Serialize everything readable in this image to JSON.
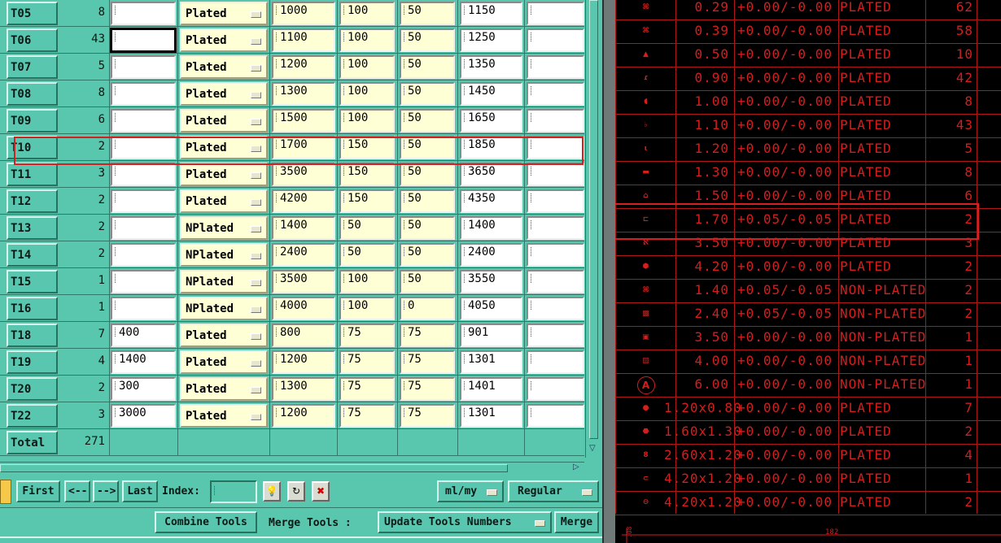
{
  "table": {
    "rows": [
      {
        "tool": "T05",
        "count": "8",
        "f1": "",
        "plating": "Plated",
        "size": "1000",
        "tol_plus": "100",
        "tol_minus": "50",
        "total": "1150",
        "f2": ""
      },
      {
        "tool": "T06",
        "count": "43",
        "f1": "",
        "plating": "Plated",
        "size": "1100",
        "tol_plus": "100",
        "tol_minus": "50",
        "total": "1250",
        "f2": ""
      },
      {
        "tool": "T07",
        "count": "5",
        "f1": "",
        "plating": "Plated",
        "size": "1200",
        "tol_plus": "100",
        "tol_minus": "50",
        "total": "1350",
        "f2": ""
      },
      {
        "tool": "T08",
        "count": "8",
        "f1": "",
        "plating": "Plated",
        "size": "1300",
        "tol_plus": "100",
        "tol_minus": "50",
        "total": "1450",
        "f2": ""
      },
      {
        "tool": "T09",
        "count": "6",
        "f1": "",
        "plating": "Plated",
        "size": "1500",
        "tol_plus": "100",
        "tol_minus": "50",
        "total": "1650",
        "f2": ""
      },
      {
        "tool": "T10",
        "count": "2",
        "f1": "",
        "plating": "Plated",
        "size": "1700",
        "tol_plus": "150",
        "tol_minus": "50",
        "total": "1850",
        "f2": ""
      },
      {
        "tool": "T11",
        "count": "3",
        "f1": "",
        "plating": "Plated",
        "size": "3500",
        "tol_plus": "150",
        "tol_minus": "50",
        "total": "3650",
        "f2": ""
      },
      {
        "tool": "T12",
        "count": "2",
        "f1": "",
        "plating": "Plated",
        "size": "4200",
        "tol_plus": "150",
        "tol_minus": "50",
        "total": "4350",
        "f2": ""
      },
      {
        "tool": "T13",
        "count": "2",
        "f1": "",
        "plating": "NPlated",
        "size": "1400",
        "tol_plus": "50",
        "tol_minus": "50",
        "total": "1400",
        "f2": ""
      },
      {
        "tool": "T14",
        "count": "2",
        "f1": "",
        "plating": "NPlated",
        "size": "2400",
        "tol_plus": "50",
        "tol_minus": "50",
        "total": "2400",
        "f2": ""
      },
      {
        "tool": "T15",
        "count": "1",
        "f1": "",
        "plating": "NPlated",
        "size": "3500",
        "tol_plus": "100",
        "tol_minus": "50",
        "total": "3550",
        "f2": ""
      },
      {
        "tool": "T16",
        "count": "1",
        "f1": "",
        "plating": "NPlated",
        "size": "4000",
        "tol_plus": "100",
        "tol_minus": "0",
        "total": "4050",
        "f2": ""
      },
      {
        "tool": "T18",
        "count": "7",
        "f1": "400",
        "plating": "Plated",
        "size": "800",
        "tol_plus": "75",
        "tol_minus": "75",
        "total": "901",
        "f2": ""
      },
      {
        "tool": "T19",
        "count": "4",
        "f1": "1400",
        "plating": "Plated",
        "size": "1200",
        "tol_plus": "75",
        "tol_minus": "75",
        "total": "1301",
        "f2": ""
      },
      {
        "tool": "T20",
        "count": "2",
        "f1": "300",
        "plating": "Plated",
        "size": "1300",
        "tol_plus": "75",
        "tol_minus": "75",
        "total": "1401",
        "f2": ""
      },
      {
        "tool": "T22",
        "count": "3",
        "f1": "3000",
        "plating": "Plated",
        "size": "1200",
        "tol_plus": "75",
        "tol_minus": "75",
        "total": "1301",
        "f2": ""
      }
    ],
    "total_label": "Total",
    "total_count": "271"
  },
  "nav": {
    "first": "First",
    "prev": "<--",
    "next": "-->",
    "last": "Last",
    "index_label": "Index:",
    "index_value": "",
    "units": "ml/my",
    "mode": "Regular"
  },
  "actions": {
    "combine": "Combine Tools",
    "merge_label": "Merge Tools :",
    "update": "Update Tools Numbers",
    "merge": "Merge"
  },
  "drill_chart": {
    "rows": [
      {
        "size": "0.29",
        "tol": "+0.00/-0.00",
        "type": "PLATED",
        "qty": "62"
      },
      {
        "size": "0.39",
        "tol": "+0.00/-0.00",
        "type": "PLATED",
        "qty": "58"
      },
      {
        "size": "0.50",
        "tol": "+0.00/-0.00",
        "type": "PLATED",
        "qty": "10"
      },
      {
        "size": "0.90",
        "tol": "+0.00/-0.00",
        "type": "PLATED",
        "qty": "42"
      },
      {
        "size": "1.00",
        "tol": "+0.00/-0.00",
        "type": "PLATED",
        "qty": "8"
      },
      {
        "size": "1.10",
        "tol": "+0.00/-0.00",
        "type": "PLATED",
        "qty": "43"
      },
      {
        "size": "1.20",
        "tol": "+0.00/-0.00",
        "type": "PLATED",
        "qty": "5"
      },
      {
        "size": "1.30",
        "tol": "+0.00/-0.00",
        "type": "PLATED",
        "qty": "8"
      },
      {
        "size": "1.50",
        "tol": "+0.00/-0.00",
        "type": "PLATED",
        "qty": "6"
      },
      {
        "size": "1.70",
        "tol": "+0.05/-0.05",
        "type": "PLATED",
        "qty": "2"
      },
      {
        "size": "3.50",
        "tol": "+0.00/-0.00",
        "type": "PLATED",
        "qty": "3"
      },
      {
        "size": "4.20",
        "tol": "+0.00/-0.00",
        "type": "PLATED",
        "qty": "2"
      },
      {
        "size": "1.40",
        "tol": "+0.05/-0.05",
        "type": "NON-PLATED",
        "qty": "2"
      },
      {
        "size": "2.40",
        "tol": "+0.05/-0.05",
        "type": "NON-PLATED",
        "qty": "2"
      },
      {
        "size": "3.50",
        "tol": "+0.00/-0.00",
        "type": "NON-PLATED",
        "qty": "1"
      },
      {
        "size": "4.00",
        "tol": "+0.00/-0.00",
        "type": "NON-PLATED",
        "qty": "1"
      },
      {
        "size": "6.00",
        "tol": "+0.00/-0.00",
        "type": "NON-PLATED",
        "qty": "1"
      },
      {
        "size": "1.20x0.80",
        "tol": "+0.00/-0.00",
        "type": "PLATED",
        "qty": "7"
      },
      {
        "size": "1.60x1.30",
        "tol": "+0.00/-0.00",
        "type": "PLATED",
        "qty": "2"
      },
      {
        "size": "2.60x1.20",
        "tol": "+0.00/-0.00",
        "type": "PLATED",
        "qty": "4"
      },
      {
        "size": "4.20x1.20",
        "tol": "+0.00/-0.00",
        "type": "PLATED",
        "qty": "1"
      },
      {
        "size": "4.20x1.20",
        "tol": "+0.00/-0.00",
        "type": "PLATED",
        "qty": "2"
      }
    ],
    "marker_letter": "A",
    "dimension": "182"
  },
  "colors": {
    "panel": "#58c7ae",
    "cad_red": "#d51e1e",
    "highlight": "#d42020"
  }
}
